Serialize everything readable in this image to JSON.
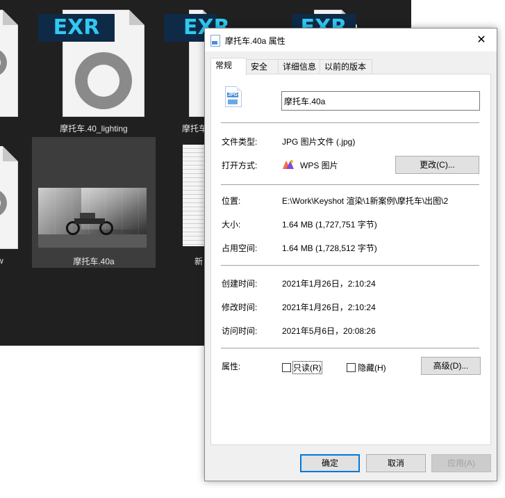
{
  "explorer": {
    "items": [
      {
        "label": "摩托车.40_lighting",
        "badge": "EXR"
      },
      {
        "label": "摩托车",
        "badge": "EXR"
      },
      {
        "label": "",
        "badge": "EXR"
      },
      {
        "label": "摩托车.40a"
      },
      {
        "label": "新"
      },
      {
        "label": "w"
      }
    ]
  },
  "dialog": {
    "title": "摩托车.40a 属性",
    "close_glyph": "✕",
    "tabs": [
      {
        "label": "常规",
        "active": true
      },
      {
        "label": "安全"
      },
      {
        "label": "详细信息"
      },
      {
        "label": "以前的版本"
      }
    ],
    "file_icon_badge": "JPG",
    "name_value": "摩托车.40a",
    "file_type": {
      "label": "文件类型:",
      "value": "JPG 图片文件 (.jpg)"
    },
    "open_with": {
      "label": "打开方式:",
      "value": "WPS 图片",
      "button": "更改(C)..."
    },
    "location": {
      "label": "位置:",
      "value": "E:\\Work\\Keyshot 渲染\\1新案例\\摩托车\\出图\\2"
    },
    "size": {
      "label": "大小:",
      "value": "1.64 MB (1,727,751 字节)"
    },
    "size_on_disk": {
      "label": "占用空间:",
      "value": "1.64 MB (1,728,512 字节)"
    },
    "created": {
      "label": "创建时间:",
      "value": "2021年1月26日，2:10:24"
    },
    "modified": {
      "label": "修改时间:",
      "value": "2021年1月26日，2:10:24"
    },
    "accessed": {
      "label": "访问时间:",
      "value": "2021年5月6日，20:08:26"
    },
    "attributes": {
      "label": "属性:",
      "readonly": "只读(R)",
      "hidden": "隐藏(H)",
      "advanced_button": "高级(D)..."
    },
    "footer": {
      "ok": "确定",
      "cancel": "取消",
      "apply": "应用(A)"
    }
  },
  "colors": {
    "accent": "#0078d7",
    "explorer_bg": "#202020",
    "exr_text": "#31c8f2"
  }
}
